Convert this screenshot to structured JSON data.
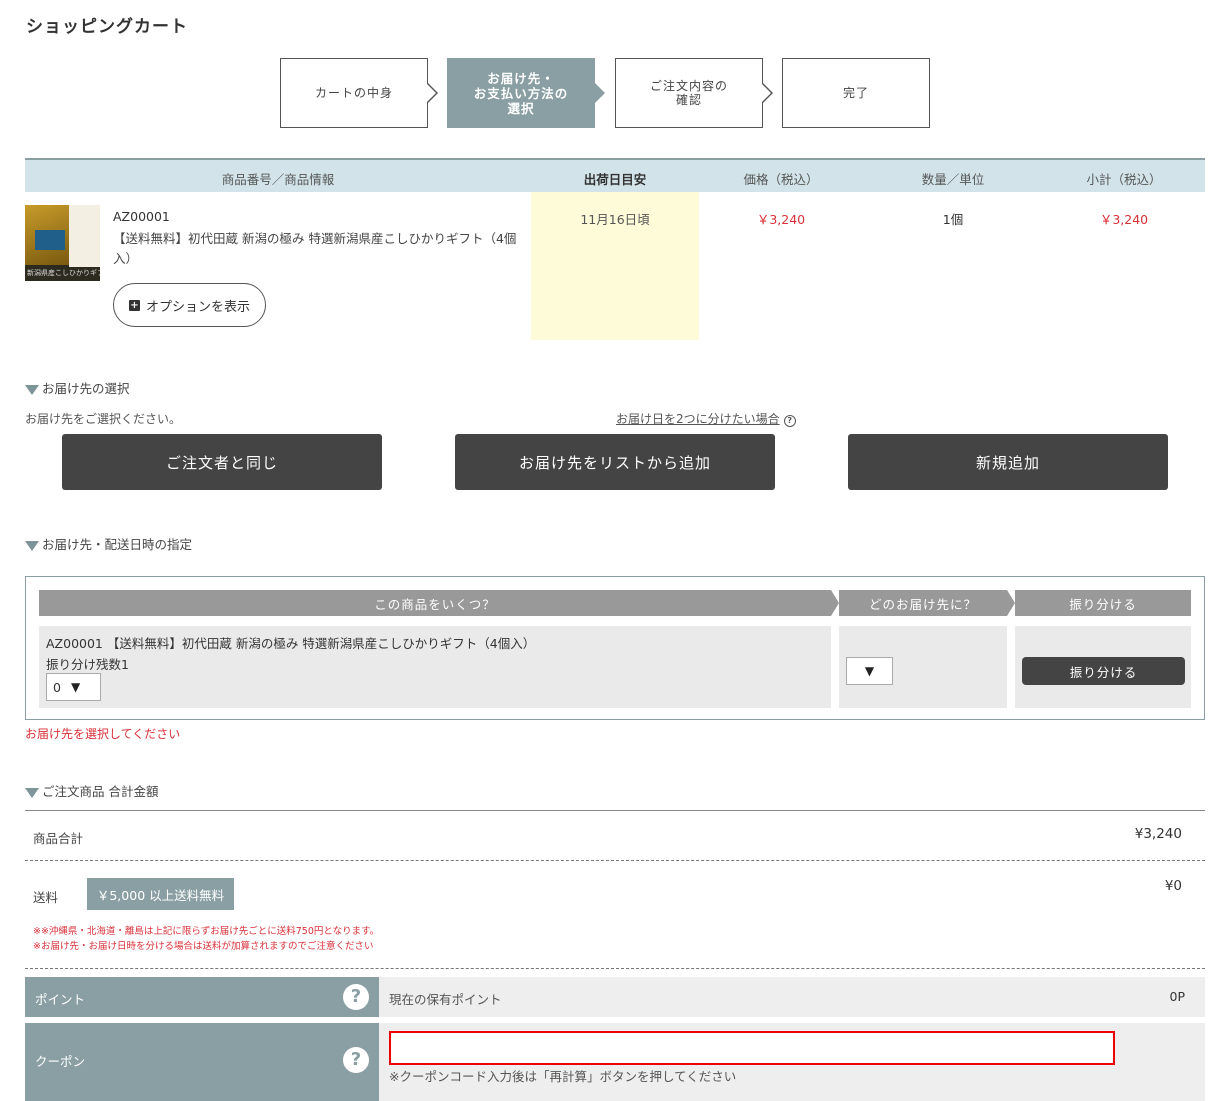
{
  "page_title": "ショッピングカート",
  "steps": [
    {
      "label": "カートの中身"
    },
    {
      "label": "お届け先・\nお支払い方法の\n選択"
    },
    {
      "label": "ご注文内容の\n確認"
    },
    {
      "label": "完了"
    }
  ],
  "cart": {
    "headers": {
      "product": "商品番号／商品情報",
      "ship": "出荷日目安",
      "price": "価格（税込）",
      "qty": "数量／単位",
      "subtotal": "小計（税込）"
    },
    "item": {
      "code": "AZ00001",
      "name": "【送料無料】初代田蔵 新潟の極み 特選新潟県産こしひかりギフト（4個入）",
      "thumb_text": "新潟県産こしひかりギフト",
      "ship_date": "11月16日頃",
      "price": "￥3,240",
      "qty": "1個",
      "subtotal": "￥3,240",
      "option_button": "オプションを表示"
    }
  },
  "delivery_select": {
    "heading": "お届け先の選択",
    "instruction": "お届け先をご選択ください。",
    "split_link": "お届け日を2つに分けたい場合",
    "buttons": [
      "ご注文者と同じ",
      "お届け先をリストから追加",
      "新規追加"
    ]
  },
  "delivery_spec": {
    "heading": "お届け先・配送日時の指定",
    "col_headers": [
      "この商品をいくつ？",
      "どのお届け先に？",
      "振り分ける"
    ],
    "item_line": "AZ00001 【送料無料】初代田蔵 新潟の極み 特選新潟県産こしひかりギフト（4個入）",
    "remaining_label": "振り分け残数1",
    "qty_value": "0",
    "dropdown_arrow": "▼",
    "split_button": "振り分ける",
    "error_note": "お届け先を選択してください"
  },
  "totals": {
    "heading": "ご注文商品 合計金額",
    "subtotal_label": "商品合計",
    "subtotal_value": "¥3,240",
    "shipping_label": "送料",
    "free_badge": "￥5,000 以上送料無料",
    "shipping_value": "¥0",
    "note1": "※※沖縄県・北海道・離島は上記に限らずお届け先ごとに送料750円となります。",
    "note2": "※お届け先・お届け日時を分ける場合は送料が加算されますのでご注意ください",
    "point_label": "ポイント",
    "point_text": "現在の保有ポイント",
    "point_value": "0P",
    "coupon_label": "クーポン",
    "coupon_value": "",
    "coupon_note": "※クーポンコード入力後は「再計算」ボタンを押してください",
    "help_glyph": "?"
  },
  "colors": {
    "accent": "#8a9fa3",
    "header_bg": "#d2e4ea",
    "ship_bg": "#fefbd9",
    "price_red": "#d9313a",
    "dark_button": "#444444"
  }
}
